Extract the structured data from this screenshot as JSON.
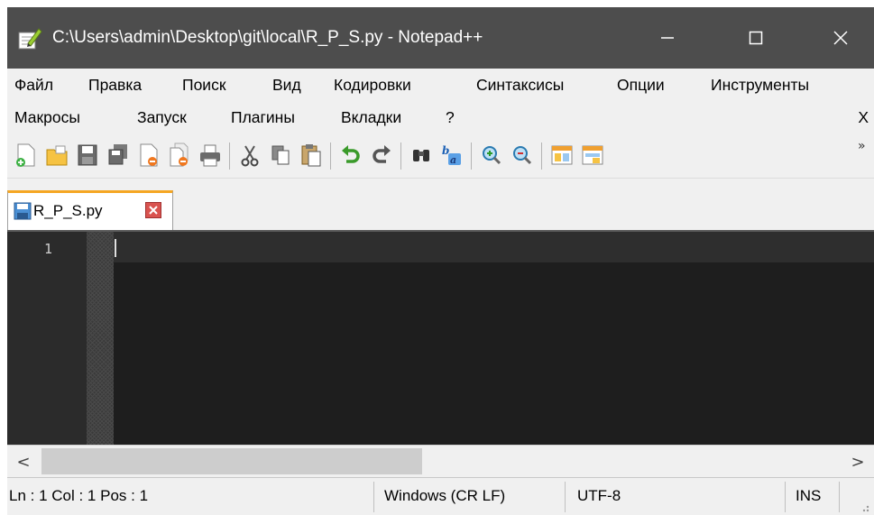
{
  "window": {
    "title": "C:\\Users\\admin\\Desktop\\git\\local\\R_P_S.py - Notepad++",
    "minimize_glyph": "—",
    "maximize_glyph": "☐",
    "close_glyph": "✕"
  },
  "menubar": {
    "row1": [
      "Файл",
      "Правка",
      "Поиск",
      "Вид",
      "Кодировки",
      "Синтаксисы",
      "Опции",
      "Инструменты"
    ],
    "row2": [
      "Макросы",
      "Запуск",
      "Плагины",
      "Вкладки",
      "?"
    ],
    "close_document": "X"
  },
  "toolbar": {
    "icons": [
      "new-file-icon",
      "open-file-icon",
      "save-icon",
      "save-all-icon",
      "close-icon",
      "close-all-icon",
      "print-icon",
      "cut-icon",
      "copy-icon",
      "paste-icon",
      "undo-icon",
      "redo-icon",
      "find-icon",
      "replace-icon",
      "zoom-in-icon",
      "zoom-out-icon",
      "sync-vertical-icon",
      "sync-horizontal-icon"
    ],
    "overflow": "»"
  },
  "tabs": [
    {
      "label": "R_P_S.py",
      "active": true,
      "icon": "save-icon"
    }
  ],
  "editor": {
    "line_numbers": [
      "1"
    ],
    "background": "#1e1e1e"
  },
  "scrollbar": {
    "left_arrow": "<",
    "right_arrow": ">"
  },
  "statusbar": {
    "position": "Ln : 1    Col : 1    Pos : 1",
    "eol": "Windows (CR LF)",
    "encoding": "UTF-8",
    "mode": "INS"
  },
  "colors": {
    "titlebar": "#4d4d4d",
    "tab_accent": "#f5a623",
    "editor_bg": "#1e1e1e",
    "gutter_bg": "#2b2b2b"
  }
}
